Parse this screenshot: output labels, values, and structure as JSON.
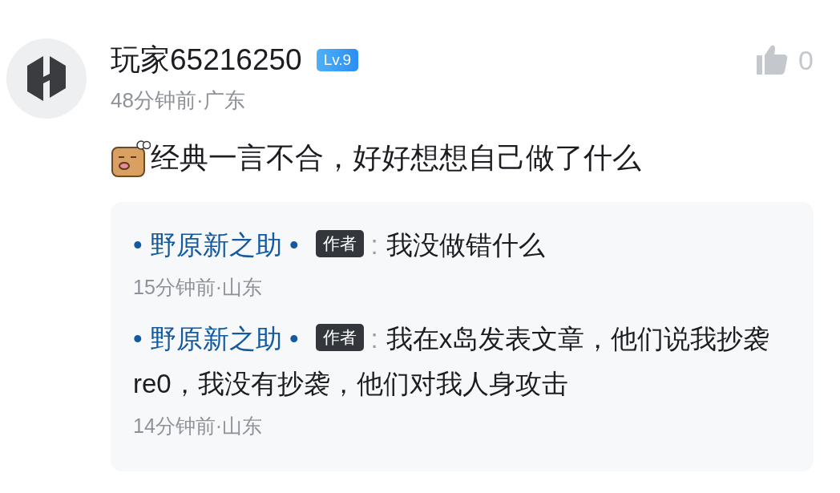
{
  "comment": {
    "author": "玩家65216250",
    "level_badge": "Lv.9",
    "meta": "48分钟前·广东",
    "likes": "0",
    "liked": false,
    "text": "经典一言不合，好好想想自己做了什么"
  },
  "replies": [
    {
      "author": "• 野原新之助 •",
      "badge": "作者",
      "separator": ":",
      "text": "我没做错什么",
      "meta": "15分钟前·山东"
    },
    {
      "author": "• 野原新之助 •",
      "badge": "作者",
      "separator": ":",
      "text": "我在x岛发表文章，他们说我抄袭re0，我没有抄袭，他们对我人身攻击",
      "meta": "14分钟前·山东"
    }
  ]
}
